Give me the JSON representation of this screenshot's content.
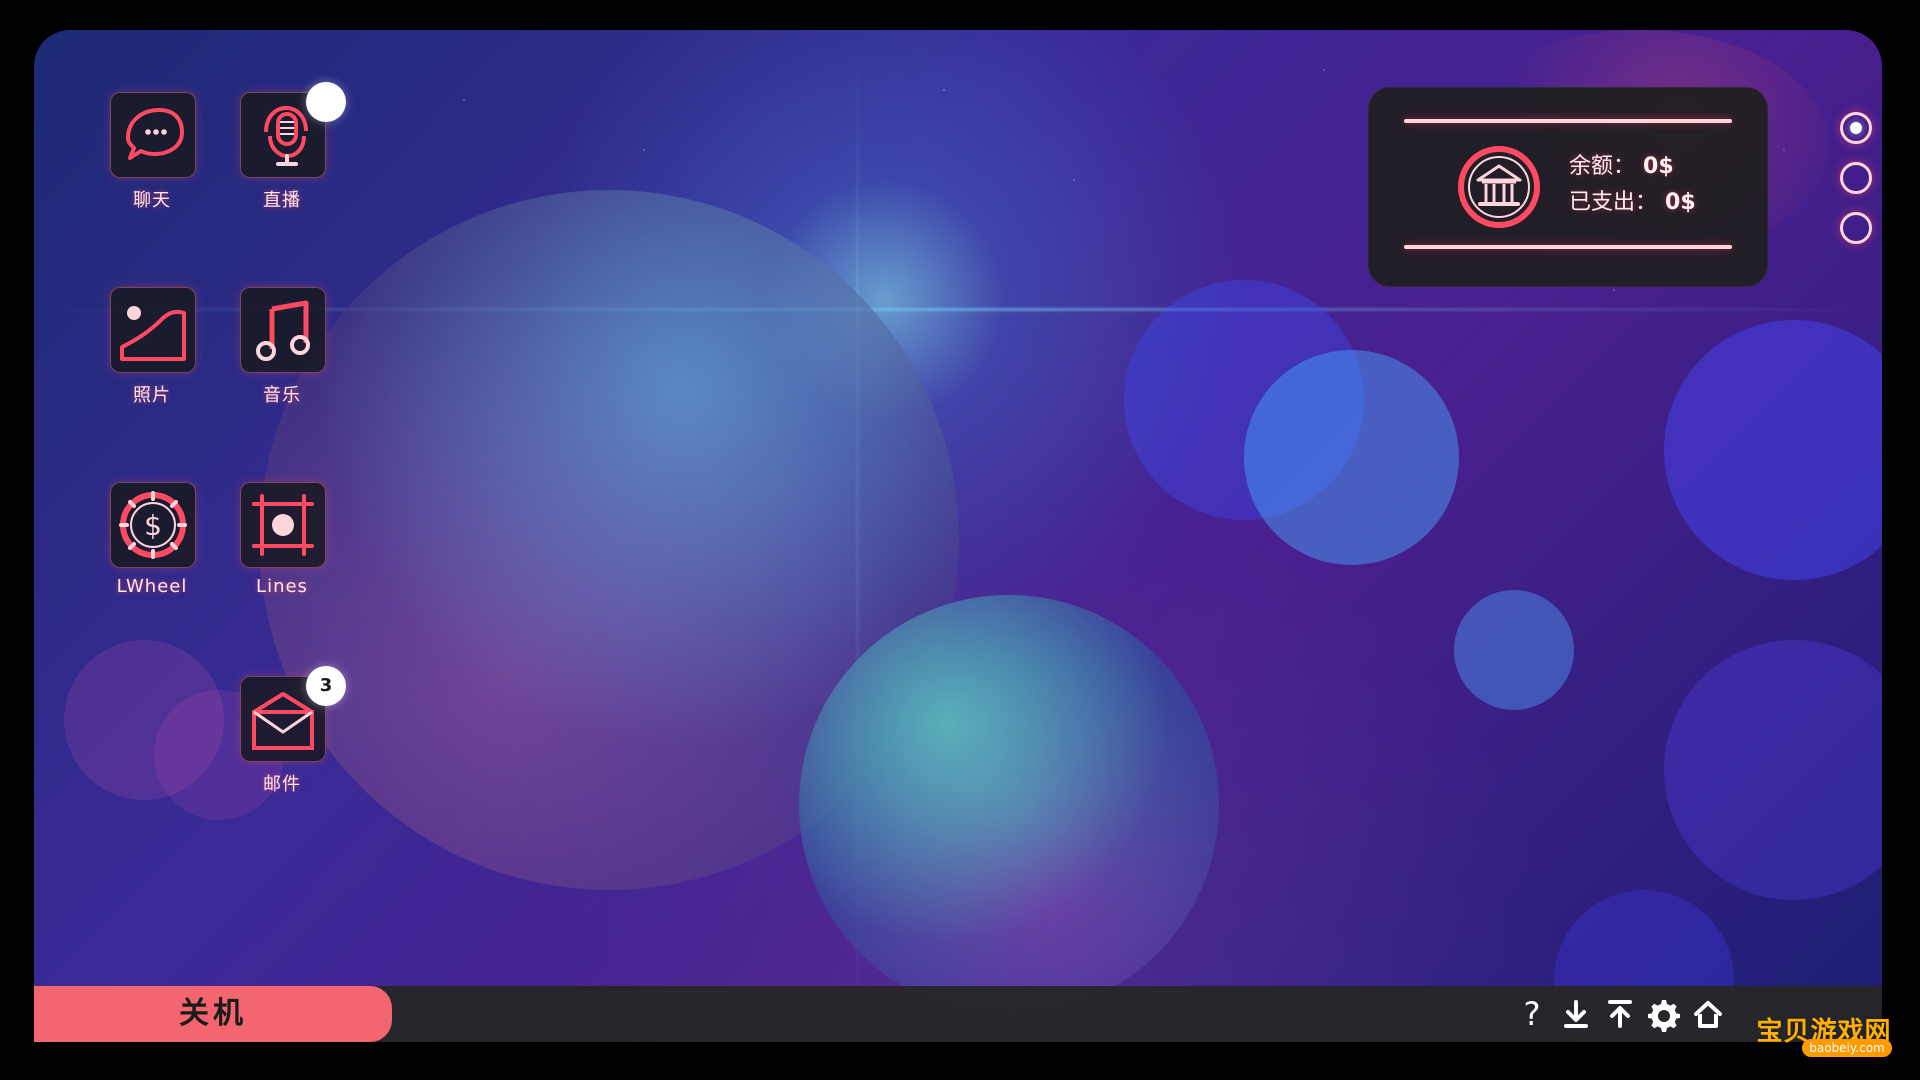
{
  "apps": [
    {
      "id": "chat",
      "label": "聊天",
      "icon": "chat-bubble-icon",
      "badge": ""
    },
    {
      "id": "live",
      "label": "直播",
      "icon": "microphone-icon",
      "badge": ""
    },
    {
      "id": "photos",
      "label": "照片",
      "icon": "photo-icon",
      "badge": ""
    },
    {
      "id": "music",
      "label": "音乐",
      "icon": "music-note-icon",
      "badge": ""
    },
    {
      "id": "lwheel",
      "label": "LWheel",
      "icon": "dollar-wheel-icon",
      "badge": ""
    },
    {
      "id": "lines",
      "label": "Lines",
      "icon": "grid-target-icon",
      "badge": ""
    },
    {
      "id": "mail",
      "label": "邮件",
      "icon": "envelope-icon",
      "badge": "3"
    }
  ],
  "bank": {
    "balance_label": "余额：",
    "balance_value": "0$",
    "spent_label": "已支出：",
    "spent_value": "0$"
  },
  "pager": {
    "pages": 3,
    "active": 1
  },
  "taskbar": {
    "power_label": "关机",
    "icons": [
      "help-icon",
      "download-icon",
      "upload-icon",
      "settings-icon",
      "home-icon"
    ]
  },
  "watermark": {
    "text": "宝贝游戏网",
    "sub": "baobeiy.com"
  },
  "colors": {
    "accent_pink": "#f36670",
    "neon_red": "#ff4a62",
    "panel_dark": "#1e1e1e"
  }
}
